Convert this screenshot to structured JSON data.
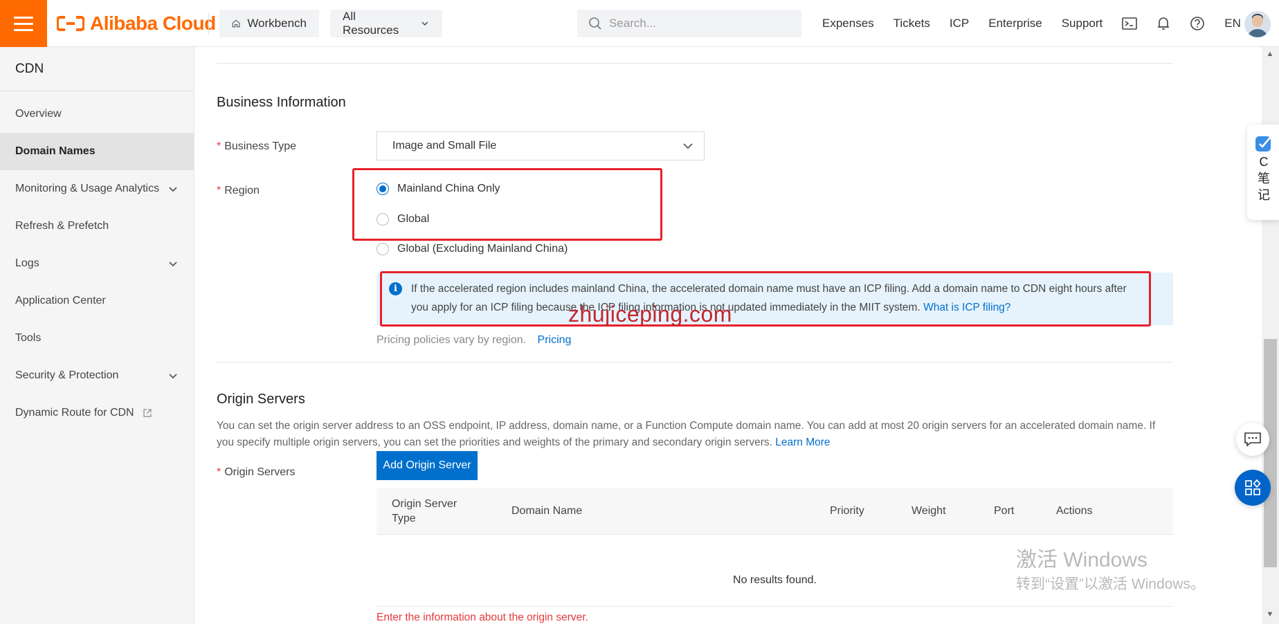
{
  "topbar": {
    "brand": "Alibaba Cloud",
    "workbench": "Workbench",
    "all_resources": "All Resources",
    "search_placeholder": "Search...",
    "links": [
      "Expenses",
      "Tickets",
      "ICP",
      "Enterprise",
      "Support"
    ],
    "language": "EN"
  },
  "sidebar": {
    "title": "CDN",
    "items": [
      {
        "label": "Overview"
      },
      {
        "label": "Domain Names"
      },
      {
        "label": "Monitoring & Usage Analytics"
      },
      {
        "label": "Refresh & Prefetch"
      },
      {
        "label": "Logs"
      },
      {
        "label": "Application Center"
      },
      {
        "label": "Tools"
      },
      {
        "label": "Security & Protection"
      },
      {
        "label": "Dynamic Route for CDN"
      }
    ]
  },
  "business": {
    "section_title": "Business Information",
    "business_type_label": "Business Type",
    "business_type_value": "Image and Small File",
    "region_label": "Region",
    "region_options": [
      "Mainland China Only",
      "Global",
      "Global (Excluding Mainland China)"
    ],
    "region_selected": "Mainland China Only",
    "info_text": "If the accelerated region includes mainland China, the accelerated domain name must have an ICP filing. Add a domain name to CDN eight hours after you apply for an ICP filing because the ICP filing information is not updated immediately in the MIIT system.",
    "info_link": "What is ICP filing?",
    "pricing_note": "Pricing policies vary by region.",
    "pricing_link": "Pricing"
  },
  "watermark": "zhujiceping.com",
  "origin": {
    "section_title": "Origin Servers",
    "description": "You can set the origin server address to an OSS endpoint, IP address, domain name, or a Function Compute domain name. You can add at most 20 origin servers for an accelerated domain name. If you specify multiple origin servers, you can set the priorities and weights of the primary and secondary origin servers.",
    "learn_more": "Learn More",
    "label": "Origin Servers",
    "add_button": "Add Origin Server",
    "columns": [
      "Origin Server Type",
      "Domain Name",
      "Priority",
      "Weight",
      "Port",
      "Actions"
    ],
    "empty_text": "No results found.",
    "error_text": "Enter the information about the origin server."
  },
  "note_widget": {
    "c": "C",
    "line1": "笔",
    "line2": "记"
  },
  "windows_activation": {
    "line1": "激活 Windows",
    "line2": "转到“设置”以激活 Windows。"
  }
}
